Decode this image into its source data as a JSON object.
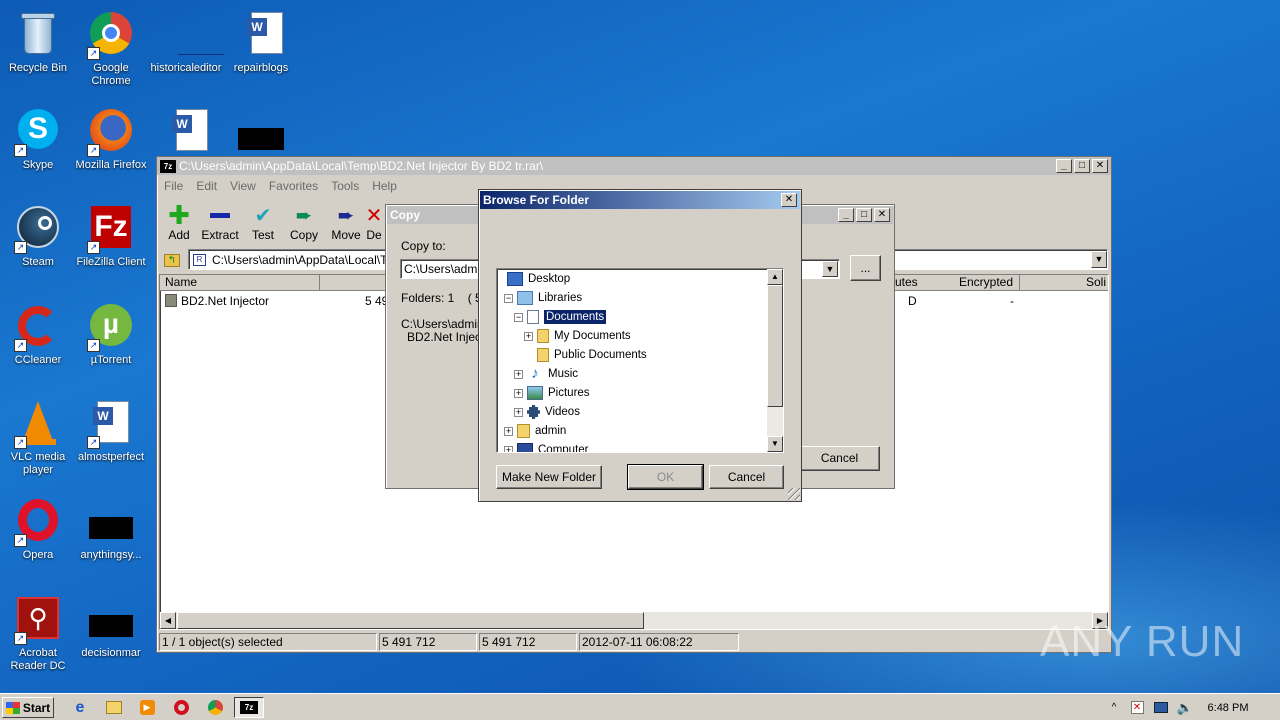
{
  "desktop": {
    "icons": [
      {
        "label": "Recycle Bin"
      },
      {
        "label": "Google Chrome"
      },
      {
        "label": "historicaleditor"
      },
      {
        "label": "repairblogs"
      },
      {
        "label": "Skype"
      },
      {
        "label": "Mozilla Firefox"
      },
      {
        "label": "Steam"
      },
      {
        "label": "FileZilla Client"
      },
      {
        "label": "CCleaner"
      },
      {
        "label": "µTorrent"
      },
      {
        "label": "VLC media player"
      },
      {
        "label": "almostperfect"
      },
      {
        "label": "Opera"
      },
      {
        "label": "anythingsy..."
      },
      {
        "label": "Acrobat Reader DC"
      },
      {
        "label": "decisionmar"
      }
    ]
  },
  "sevenzip": {
    "title": "C:\\Users\\admin\\AppData\\Local\\Temp\\BD2.Net Injector By BD2 tr.rar\\",
    "menu": [
      "File",
      "Edit",
      "View",
      "Favorites",
      "Tools",
      "Help"
    ],
    "toolbar": [
      "Add",
      "Extract",
      "Test",
      "Copy",
      "Move",
      "De"
    ],
    "address": "C:\\Users\\admin\\AppData\\Local\\Tem",
    "columns": {
      "name": "Name",
      "attributes": "utes",
      "encrypted": "Encrypted",
      "solid": "Soli"
    },
    "rows": [
      {
        "name": "BD2.Net Injector",
        "size": "5 49",
        "attr": "D",
        "enc": "-"
      }
    ],
    "status": {
      "selected": "1 / 1 object(s) selected",
      "size": "5 491 712",
      "packed": "5 491 712",
      "date": "2012-07-11 06:08:22"
    }
  },
  "copy_dialog": {
    "title": "Copy",
    "copy_to_label": "Copy to:",
    "path_value": "C:\\Users\\admin",
    "browse_label": "...",
    "folders_info": "Folders: 1    ( 5 4",
    "path_line1": "C:\\Users\\admin\\",
    "path_line2": "BD2.Net Inject",
    "cancel": "Cancel"
  },
  "browse_dialog": {
    "title": "Browse For Folder",
    "close": "✕",
    "tree": [
      {
        "label": "Desktop",
        "exp": ""
      },
      {
        "label": "Libraries",
        "exp": "−"
      },
      {
        "label": "Documents",
        "exp": "−",
        "selected": true
      },
      {
        "label": "My Documents",
        "exp": "+"
      },
      {
        "label": "Public Documents",
        "exp": ""
      },
      {
        "label": "Music",
        "exp": "+"
      },
      {
        "label": "Pictures",
        "exp": "+"
      },
      {
        "label": "Videos",
        "exp": "+"
      },
      {
        "label": "admin",
        "exp": "+"
      },
      {
        "label": "Computer",
        "exp": "+"
      }
    ],
    "make_new_folder": "Make New Folder",
    "ok": "OK",
    "cancel": "Cancel"
  },
  "taskbar": {
    "start": "Start",
    "clock": "6:48 PM",
    "tray_expand": "^"
  },
  "watermark": "ANY RUN"
}
